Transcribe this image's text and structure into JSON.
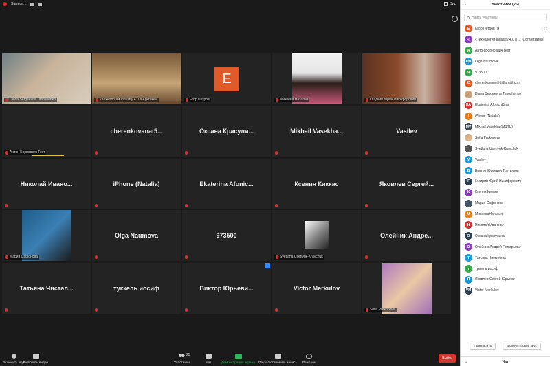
{
  "topbar": {
    "recording_label": "Запись...",
    "view_label": "Вид"
  },
  "tiles": [
    {
      "label": "Diana Sergeevna Timoshenko",
      "photo": "woman-blonde"
    },
    {
      "label": "«Технологии Industry 4.0 в Арктике»",
      "photo": "conference-room",
      "active": true
    },
    {
      "label": "Егор Петров",
      "avatar": "E"
    },
    {
      "label": "Михеева Наталия",
      "photo": "woman-dark"
    },
    {
      "label": "Гладкий Юрий Никифорович",
      "photo": "man-books"
    },
    {
      "label": "Антон Борисович Гехт",
      "speaking": true
    },
    {
      "name": "cherenkovanat5..."
    },
    {
      "name": "Оксана Красули..."
    },
    {
      "name": "Mikhail Vasekha..."
    },
    {
      "name": "Vasilev"
    },
    {
      "name": "Николай Ивано..."
    },
    {
      "name": "iPhone (Natalia)"
    },
    {
      "name": "Ekaterina Afonic..."
    },
    {
      "name": "Ксения Киккас"
    },
    {
      "name": "Яковлев Сергей..."
    },
    {
      "label": "Мария Сафонова",
      "photo": "woman-blue"
    },
    {
      "name": "Olga Naumova"
    },
    {
      "name": "973500"
    },
    {
      "label": "Svetlana Usenyuk-Kravchuk",
      "photo": "bw-photo"
    },
    {
      "name": "Олейник Андре..."
    },
    {
      "name": "Татьяна Чистал..."
    },
    {
      "name": "туккель иосиф"
    },
    {
      "name": "Виктор Юрьеви..."
    },
    {
      "name": "Victor Merkulov"
    },
    {
      "label": "Sofia Prokopova",
      "photo": "woman-curly"
    }
  ],
  "toolbar": {
    "mute": "Включить звук",
    "video": "Включить видео",
    "participants": "Участники",
    "participants_count": "25",
    "chat": "Чат",
    "share": "Демонстрация экрана",
    "record": "Пауза/остановить запись",
    "reactions": "Реакции",
    "leave": "Выйти"
  },
  "panel": {
    "title": "Участники (25)",
    "search_placeholder": "Найти участника",
    "invite": "Пригласить",
    "unmute": "Включить свой звук",
    "chat_title": "Чат"
  },
  "participants": [
    {
      "name": "Егор Петров (Я)",
      "initials": "E",
      "color": "#e15a2a"
    },
    {
      "name": "«Технологии Industry 4.0 в ... (Организатор)",
      "initials": "«",
      "color": "#8a3db8"
    },
    {
      "name": "Антон Борисович Гехт",
      "initials": "А",
      "color": "#3aa84c"
    },
    {
      "name": "Olga Naumova",
      "initials": "ON",
      "color": "#1f9ad6"
    },
    {
      "name": "973500",
      "initials": "9",
      "color": "#3aa84c"
    },
    {
      "name": "cherenkovanat51@gmail.com",
      "initials": "C",
      "color": "#e15a2a"
    },
    {
      "name": "Diana Sergeevna Timoshenko",
      "initials": "",
      "color": "#c9a27a"
    },
    {
      "name": "Ekaterina AfonichKina",
      "initials": "EA",
      "color": "#d93434"
    },
    {
      "name": "iPhone (Natalia)",
      "initials": "I",
      "color": "#e67e22"
    },
    {
      "name": "Mikhail Vasekha (MSTU)",
      "initials": "MV",
      "color": "#3f4a56"
    },
    {
      "name": "Sofia Prokopova",
      "initials": "",
      "color": "#d8b58c"
    },
    {
      "name": "Svetlana Usenyuk-Kravchuk",
      "initials": "",
      "color": "#555555"
    },
    {
      "name": "Vasilev",
      "initials": "V",
      "color": "#1f9ad6"
    },
    {
      "name": "Виктор Юрьевич Третьяков",
      "initials": "В",
      "color": "#1f9ad6"
    },
    {
      "name": "Гладкий Юрий Никифорович",
      "initials": "Г",
      "color": "#2c3e50"
    },
    {
      "name": "Ксения Киккас",
      "initials": "К",
      "color": "#8a3db8"
    },
    {
      "name": "Мария Сафонова",
      "initials": "",
      "color": "#445566"
    },
    {
      "name": "МихееваНаталия",
      "initials": "М",
      "color": "#e67e22"
    },
    {
      "name": "Николай Иванович",
      "initials": "Н",
      "color": "#d93434"
    },
    {
      "name": "Оксана Красулина",
      "initials": "О",
      "color": "#2c3e50"
    },
    {
      "name": "Олейник Андрей Григорьевич",
      "initials": "О",
      "color": "#8a3db8"
    },
    {
      "name": "Татьяна Чистилева",
      "initials": "Т",
      "color": "#1f9ad6"
    },
    {
      "name": "туккель иосиф",
      "initials": "т",
      "color": "#3aa84c"
    },
    {
      "name": "Яковлев Сергей Юрьевич",
      "initials": "Я",
      "color": "#1f9ad6"
    },
    {
      "name": "Victor Merkulov",
      "initials": "VM",
      "color": "#2c3e50"
    }
  ]
}
